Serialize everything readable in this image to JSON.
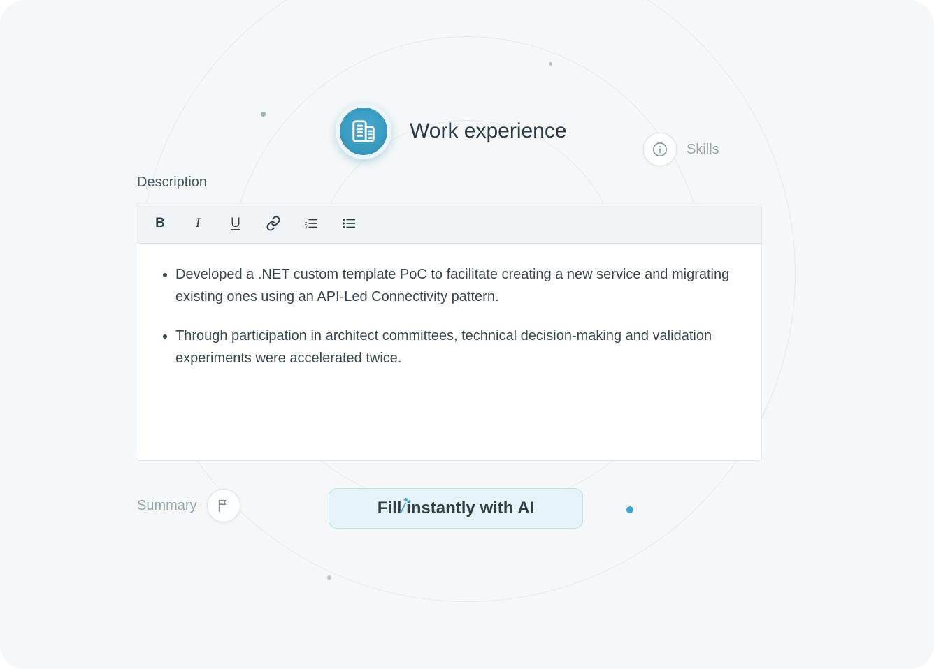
{
  "section": {
    "title": "Work experience"
  },
  "editor": {
    "label": "Description",
    "bullets": [
      "Developed a .NET custom template PoC to facilitate creating a new service and migrating existing ones using an API-Led Connectivity pattern.",
      "Through participation in architect committees, technical decision-making and validation experiments were accelerated twice."
    ]
  },
  "aiButton": {
    "label": "Fill instantly with AI"
  },
  "orbit": {
    "skills": {
      "label": "Skills"
    },
    "summary": {
      "label": "Summary"
    }
  },
  "toolbar": {
    "bold": "B",
    "italic": "I",
    "underline": "U"
  }
}
